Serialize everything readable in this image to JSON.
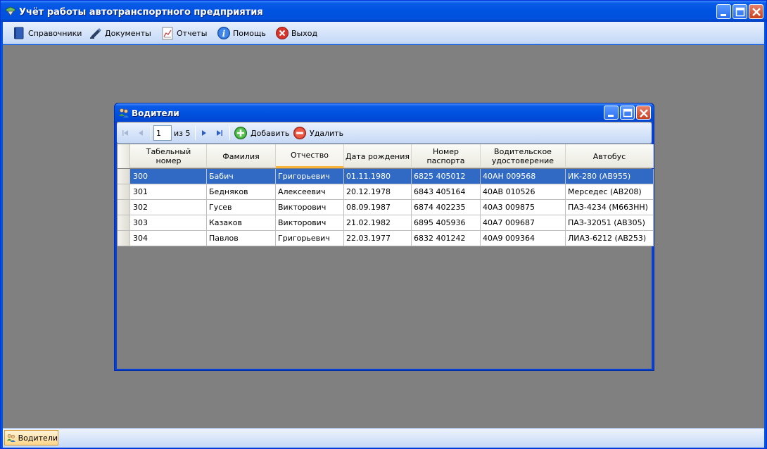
{
  "app": {
    "title": "Учёт работы автотранспортного предприятия"
  },
  "menu": {
    "items": [
      {
        "label": "Справочники",
        "icon": "book-icon"
      },
      {
        "label": "Документы",
        "icon": "document-pen-icon"
      },
      {
        "label": "Отчеты",
        "icon": "report-chart-icon"
      },
      {
        "label": "Помощь",
        "icon": "info-icon"
      },
      {
        "label": "Выход",
        "icon": "exit-icon"
      }
    ]
  },
  "child": {
    "title": "Водители",
    "navigator": {
      "position": "1",
      "of_label": "из 5",
      "add_label": "Добавить",
      "delete_label": "Удалить"
    }
  },
  "grid": {
    "columns": [
      "Табельный номер",
      "Фамилия",
      "Отчество",
      "Дата рождения",
      "Номер паспорта",
      "Водительское удостоверение",
      "Автобус"
    ],
    "sorted_column": 2,
    "selected_row": 0,
    "rows": [
      [
        "300",
        "Бабич",
        "Григорьевич",
        "01.11.1980",
        "6825 405012",
        "40АН 009568",
        "ИК-280 (АВ955)"
      ],
      [
        "301",
        "Бедняков",
        "Алексеевич",
        "20.12.1978",
        "6843 405164",
        "40АВ 010526",
        "Мерседес (АВ208)"
      ],
      [
        "302",
        "Гусев",
        "Викторович",
        "08.09.1987",
        "6874 402235",
        "40А3 009875",
        "ПАЗ-4234 (М663НН)"
      ],
      [
        "303",
        "Казаков",
        "Викторович",
        "21.02.1982",
        "6895 405936",
        "40А7 009687",
        "ПАЗ-32051 (АВ305)"
      ],
      [
        "304",
        "Павлов",
        "Григорьевич",
        "22.03.1977",
        "6832 401242",
        "40А9 009364",
        "ЛИАЗ-6212 (АВ253)"
      ]
    ]
  },
  "taskbar": {
    "window_label": "Водители"
  },
  "colors": {
    "titlebar": "#0053e0",
    "selection": "#316ac5",
    "mdi_background": "#808080",
    "sort_indicator": "#f9b43a"
  }
}
